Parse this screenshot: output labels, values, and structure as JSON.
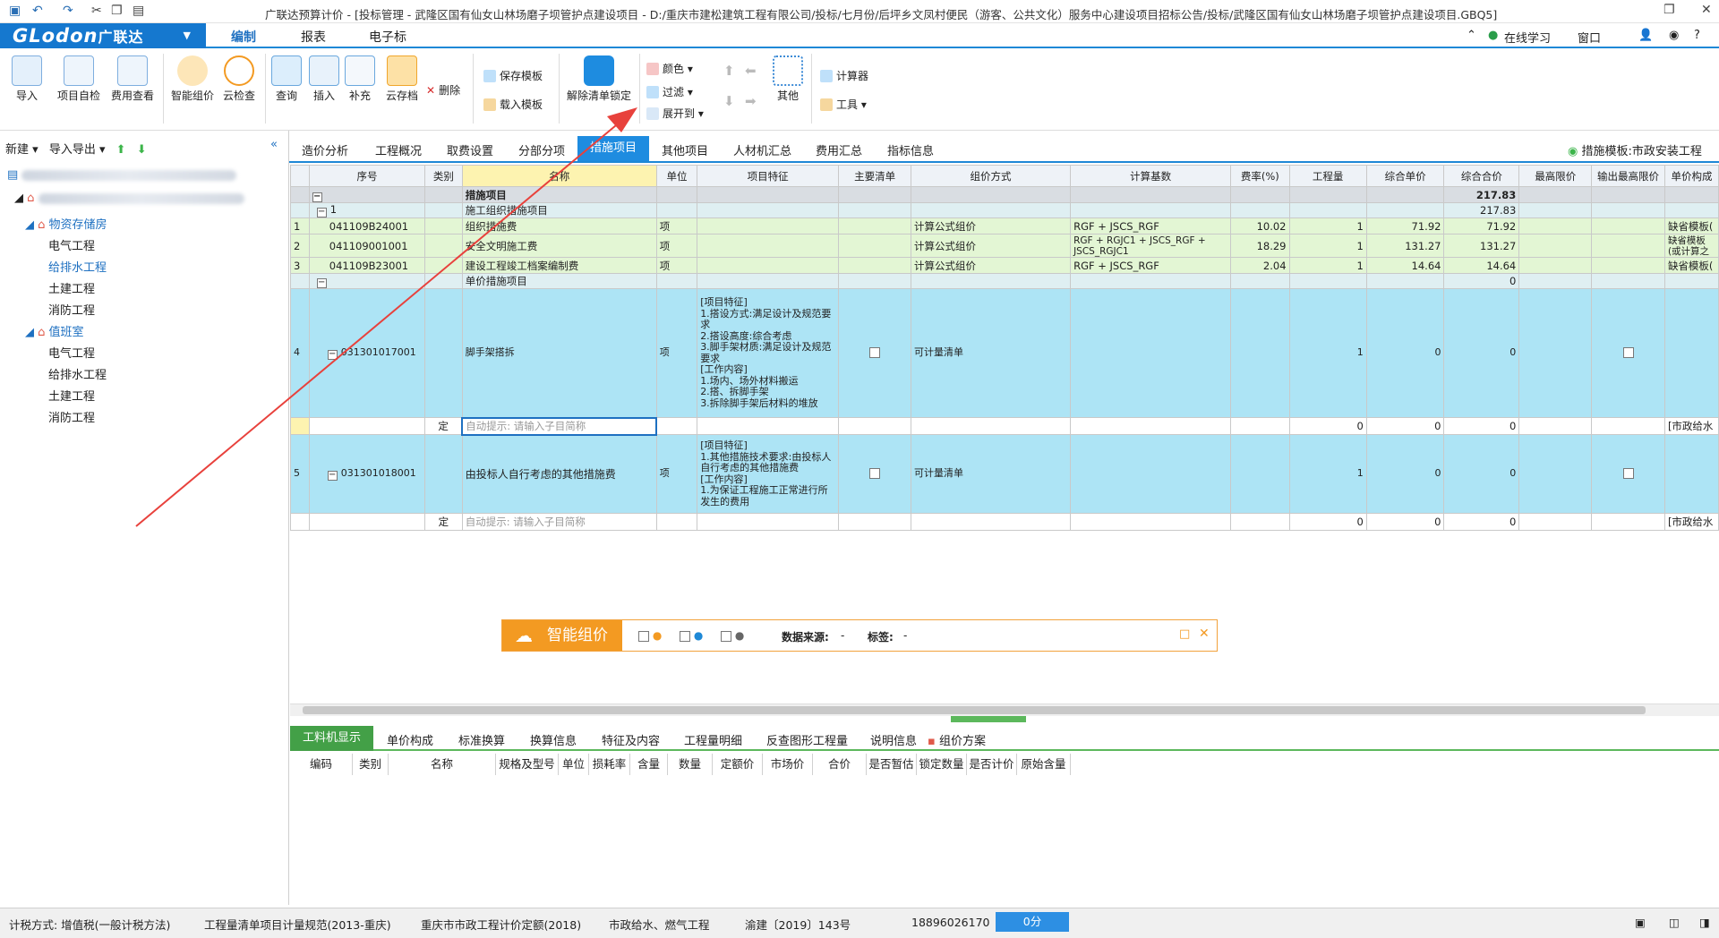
{
  "window": {
    "title": "广联达预算计价 - [投标管理 - 武隆区国有仙女山林场磨子坝管护点建设项目 - D:/重庆市建松建筑工程有限公司/投标/七月份/后坪乡文凤村便民（游客、公共文化）服务中心建设项目招标公告/投标/武隆区国有仙女山林场磨子坝管护点建设项目.GBQ5]"
  },
  "menu": {
    "logo": "GLodon",
    "logo_cn": "广联达",
    "tabs": [
      "编制",
      "报表",
      "电子标"
    ],
    "right": [
      "在线学习",
      "窗口"
    ]
  },
  "ribbon": {
    "buttons": [
      "导入",
      "项目自检",
      "费用查看",
      "智能组价",
      "云检查",
      "查询",
      "插入",
      "补充",
      "云存档"
    ],
    "delete": "删除",
    "save_template": "保存模板",
    "load_template": "载入模板",
    "unlock": "解除清单锁定",
    "color": "颜色",
    "filter": "过滤",
    "expand": "展开到",
    "other": "其他",
    "calculator": "计算器",
    "tools": "工具"
  },
  "left": {
    "new": "新建",
    "import_export": "导入导出",
    "tree": [
      {
        "label": "物资存储房",
        "children": [
          "电气工程",
          "给排水工程",
          "土建工程",
          "消防工程"
        ]
      },
      {
        "label": "值班室",
        "children": [
          "电气工程",
          "给排水工程",
          "土建工程",
          "消防工程"
        ]
      }
    ]
  },
  "page_tabs": [
    "造价分析",
    "工程概况",
    "取费设置",
    "分部分项",
    "措施项目",
    "其他项目",
    "人材机汇总",
    "费用汇总",
    "指标信息"
  ],
  "template_label": "措施模板:市政安装工程",
  "grid": {
    "headers": [
      "序号",
      "类别",
      "名称",
      "单位",
      "项目特征",
      "主要清单",
      "组价方式",
      "计算基数",
      "费率(%)",
      "工程量",
      "综合单价",
      "综合合价",
      "最高限价",
      "输出最高限价",
      "单价构成"
    ],
    "root": {
      "name": "措施项目",
      "total": "217.83"
    },
    "group1": {
      "no": "1",
      "name": "施工组织措施项目",
      "total": "217.83"
    },
    "rows": [
      {
        "idx": "1",
        "code": "041109B24001",
        "name": "组织措施费",
        "unit": "项",
        "method": "计算公式组价",
        "base": "RGF + JSCS_RGF",
        "rate": "10.02",
        "qty": "1",
        "price": "71.92",
        "total": "71.92",
        "comp": "缺省模板("
      },
      {
        "idx": "2",
        "code": "041109001001",
        "name": "安全文明施工费",
        "unit": "项",
        "method": "计算公式组价",
        "base": "RGF + RGJC1 + JSCS_RGF + JSCS_RGJC1",
        "rate": "18.29",
        "qty": "1",
        "price": "131.27",
        "total": "131.27",
        "comp": "缺省模板(或计算之"
      },
      {
        "idx": "3",
        "code": "041109B23001",
        "name": "建设工程竣工档案编制费",
        "unit": "项",
        "method": "计算公式组价",
        "base": "RGF + JSCS_RGF",
        "rate": "2.04",
        "qty": "1",
        "price": "14.64",
        "total": "14.64",
        "comp": "缺省模板("
      }
    ],
    "group2": {
      "name": "单价措施项目",
      "total": "0"
    },
    "row4": {
      "idx": "4",
      "code": "031301017001",
      "name": "脚手架搭拆",
      "unit": "项",
      "feature": "[项目特征]\n1.搭设方式:满足设计及规范要求\n2.搭设高度:综合考虑\n3.脚手架材质:满足设计及规范要求\n[工作内容]\n1.场内、场外材料搬运\n2.搭、拆脚手架\n3.拆除脚手架后材料的堆放",
      "method": "可计量清单",
      "qty": "1",
      "price": "0",
      "total": "0"
    },
    "sub4": {
      "type": "定",
      "hint": "自动提示: 请输入子目简称",
      "qty": "0",
      "price": "0",
      "total": "0",
      "comp": "[市政给水"
    },
    "row5": {
      "idx": "5",
      "code": "031301018001",
      "name": "由投标人自行考虑的其他措施费",
      "unit": "项",
      "feature": "[项目特征]\n1.其他措施技术要求:由投标人自行考虑的其他措施费\n[工作内容]\n1.为保证工程施工正常进行所发生的费用",
      "method": "可计量清单",
      "qty": "1",
      "price": "0",
      "total": "0"
    },
    "sub5": {
      "type": "定",
      "hint": "自动提示: 请输入子目简称",
      "qty": "0",
      "price": "0",
      "total": "0",
      "comp": "[市政给水"
    }
  },
  "smart": {
    "title": "智能组价",
    "src_label": "数据来源:",
    "src_val": "-",
    "tag_label": "标签:",
    "tag_val": "-"
  },
  "bottom_tabs": [
    "工料机显示",
    "单价构成",
    "标准换算",
    "换算信息",
    "特征及内容",
    "工程量明细",
    "反查图形工程量",
    "说明信息",
    "组价方案"
  ],
  "bottom_headers": [
    "编码",
    "类别",
    "名称",
    "规格及型号",
    "单位",
    "损耗率",
    "含量",
    "数量",
    "定额价",
    "市场价",
    "合价",
    "是否暂估",
    "锁定数量",
    "是否计价",
    "原始含量"
  ],
  "status": {
    "items": [
      "计税方式: 增值税(一般计税方法)",
      "工程量清单项目计量规范(2013-重庆)",
      "重庆市市政工程计价定额(2018)",
      "市政给水、燃气工程",
      "渝建〔2019〕143号",
      "18896026170"
    ],
    "score": "0分"
  },
  "colors": {
    "brand": "#1578cf",
    "accent": "#1e88d6",
    "row_blue": "#ade4f5",
    "row_green": "#e3f6d4",
    "smart": "#f39a22",
    "annotation": "#e8413c"
  }
}
